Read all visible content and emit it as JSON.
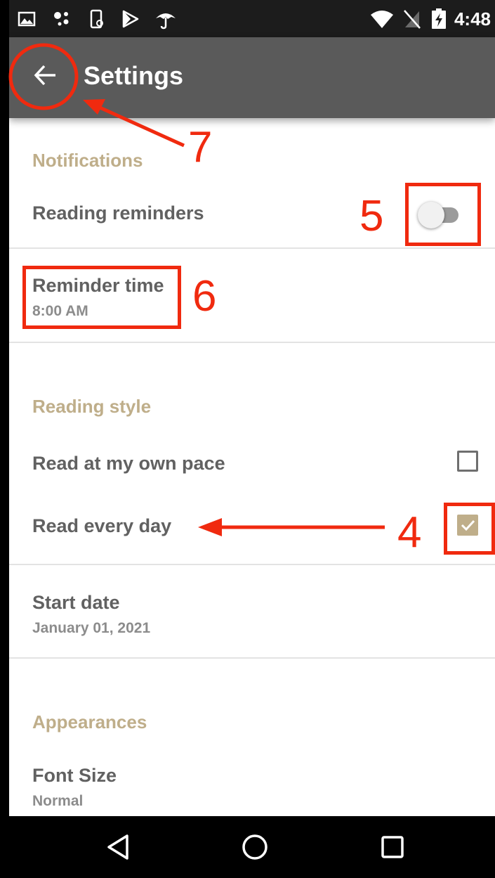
{
  "status_bar": {
    "time": "4:48",
    "left_icons": [
      "photo-icon",
      "assistant-dots-icon",
      "phone-sync-icon",
      "play-store-icon",
      "umbrella-icon"
    ],
    "right_icons": [
      "wifi-icon",
      "no-sim-icon",
      "battery-charging-icon"
    ]
  },
  "app_bar": {
    "title": "Settings",
    "back_icon": "arrow-left-icon"
  },
  "sections": {
    "notifications": {
      "header": "Notifications",
      "reading_reminders": {
        "title": "Reading reminders",
        "enabled": false
      },
      "reminder_time": {
        "title": "Reminder time",
        "summary": "8:00 AM"
      }
    },
    "reading_style": {
      "header": "Reading style",
      "own_pace": {
        "title": "Read at my own pace",
        "checked": false
      },
      "every_day": {
        "title": "Read every day",
        "checked": true
      },
      "start_date": {
        "title": "Start date",
        "summary": "January 01, 2021"
      }
    },
    "appearances": {
      "header": "Appearances",
      "font_size": {
        "title": "Font Size",
        "summary": "Normal"
      }
    }
  },
  "nav_bar": {
    "buttons": [
      "back-triangle-icon",
      "home-circle-icon",
      "recents-square-icon"
    ]
  },
  "annotations": {
    "labels": [
      "7",
      "5",
      "6",
      "4"
    ],
    "color": "#f02a0f"
  },
  "colors": {
    "accent": "#bfae8a",
    "app_bar": "#5a5a5a",
    "status_bar": "#1c1c1c"
  }
}
